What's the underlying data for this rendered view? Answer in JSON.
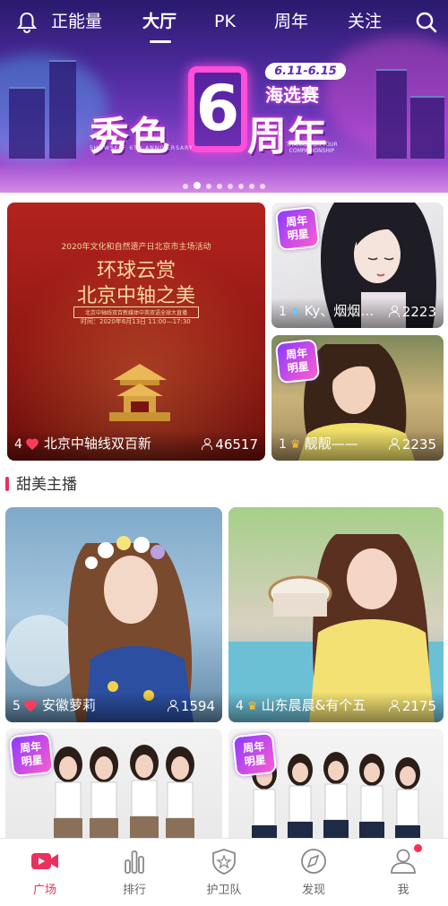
{
  "nav": {
    "tabs": [
      {
        "label": "正能量"
      },
      {
        "label": "大厅"
      },
      {
        "label": "PK"
      },
      {
        "label": "周年"
      },
      {
        "label": "关注"
      }
    ],
    "active_tab": "大厅"
  },
  "banner": {
    "title_left": "秀色",
    "title_digit": "6",
    "title_right": "周年",
    "dates": "6.11-6.15",
    "event": "海选赛",
    "tagline_left": "SHOWSELF 6TH ANNIVERSARY",
    "tagline_right": "THANKS FOR YOUR COMPANIONSHIP",
    "page_count": 8,
    "active_page": 1
  },
  "featured": [
    {
      "poster_kicker": "2020年文化和自然遗产日北京市主场活动",
      "poster_title_1": "环球云赏",
      "poster_title_2": "北京中轴之美",
      "poster_tag": "北京中轴线双百新媒体中英双语全球大直播",
      "poster_time": "时间：2020年6月13日 11:00—17:30",
      "count": "4",
      "name": "北京中轴线双百新",
      "viewers": "46517"
    },
    {
      "badge": "周年明星",
      "count": "1",
      "name": "Ky、烟烟…",
      "viewers": "2223"
    },
    {
      "badge": "周年明星",
      "count": "1",
      "name": "靓靓——",
      "viewers": "2235"
    }
  ],
  "section_title": "甜美主播",
  "streams": [
    {
      "count": "5",
      "name": "安徽萝莉",
      "viewers": "1594"
    },
    {
      "count": "4",
      "name": "山东晨晨&有个五",
      "viewers": "2175"
    },
    {
      "badge": "周年明星"
    },
    {
      "badge": "周年明星"
    }
  ],
  "tabbar": [
    {
      "label": "广场",
      "icon": "video-icon"
    },
    {
      "label": "排行",
      "icon": "chart-icon"
    },
    {
      "label": "护卫队",
      "icon": "shield-icon"
    },
    {
      "label": "发现",
      "icon": "compass-icon"
    },
    {
      "label": "我",
      "icon": "person-icon"
    }
  ],
  "colors": {
    "accent": "#e8315c",
    "banner": "#4b2a9a",
    "badge": "#8b3bff"
  }
}
